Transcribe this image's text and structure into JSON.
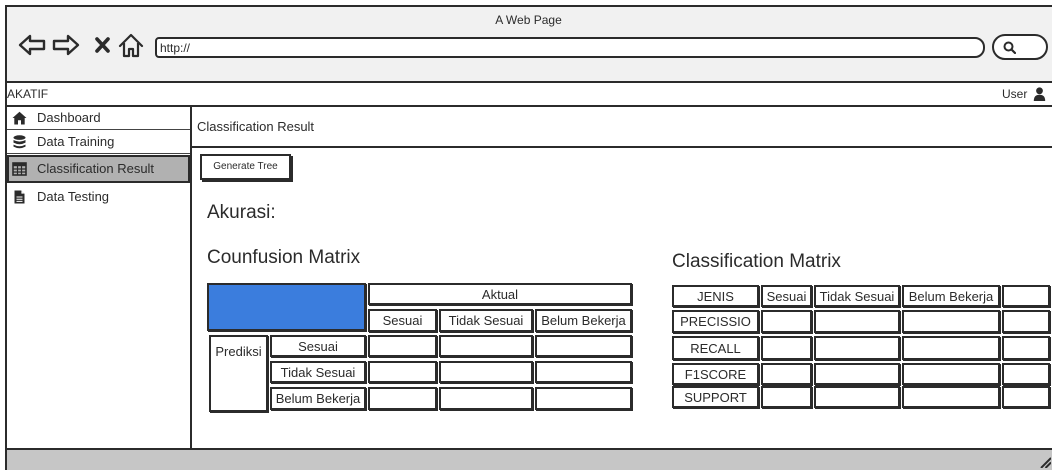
{
  "window": {
    "title": "A Web Page",
    "url": "http://"
  },
  "toolbar": {
    "icons": {
      "back": "back-arrow-icon",
      "forward": "forward-arrow-icon",
      "stop": "close-icon",
      "home": "home-icon",
      "search": "search-icon"
    }
  },
  "app": {
    "brand": "AKATIF",
    "user_label": "User",
    "user_icon": "user-icon"
  },
  "sidebar": {
    "items": [
      {
        "label": "Dashboard",
        "icon": "home-icon",
        "selected": false
      },
      {
        "label": "Data Training",
        "icon": "database-icon",
        "selected": false
      },
      {
        "label": "Classification Result",
        "icon": "table-icon",
        "selected": true
      },
      {
        "label": "Data Testing",
        "icon": "file-icon",
        "selected": false
      }
    ]
  },
  "main": {
    "header": "Classification Result",
    "generate_button": "Generate Tree",
    "accuracy_label": "Akurasi:",
    "confusion_matrix": {
      "title": "Counfusion Matrix",
      "actual_label": "Aktual",
      "actual_columns": [
        "Sesuai",
        "Tidak Sesuai",
        "Belum Bekerja"
      ],
      "predicted_label": "Prediksi",
      "predicted_rows": [
        "Sesuai",
        "Tidak Sesuai",
        "Belum Bekerja"
      ]
    },
    "classification_matrix": {
      "title": "Classification Matrix",
      "columns": [
        "JENIS",
        "Sesuai",
        "Tidak Sesuai",
        "Belum Bekerja"
      ],
      "rows": [
        "PRECISSIO",
        "RECALL",
        "F1SCORE",
        "SUPPORT"
      ]
    }
  },
  "colors": {
    "ink": "#2b2b2b",
    "accent_blue": "#3b7ddd",
    "selected_item": "#b1b1b1",
    "chrome_bg": "#f1f1f1",
    "status_bar": "#c6c6c6"
  }
}
